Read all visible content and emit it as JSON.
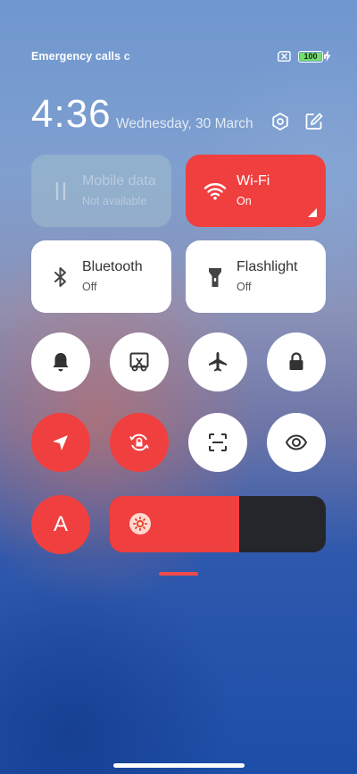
{
  "status_bar": {
    "carrier": "Emergency calls",
    "carrier_suffix": "c",
    "battery_level": 100,
    "battery_text": "100",
    "sim_icon": "sim-error-icon",
    "charging_icon": "bolt-icon"
  },
  "header": {
    "time": "4:36",
    "date": "Wednesday, 30 March",
    "settings_icon": "settings-hexagon-icon",
    "edit_icon": "edit-icon"
  },
  "tiles": {
    "mobile_data": {
      "label": "Mobile data",
      "status": "Not available",
      "icon": "data-arrows-icon"
    },
    "wifi": {
      "label": "Wi-Fi",
      "status": "On",
      "icon": "wifi-icon"
    },
    "bluetooth": {
      "label": "Bluetooth",
      "status": "Off",
      "icon": "bluetooth-icon"
    },
    "flashlight": {
      "label": "Flashlight",
      "status": "Off",
      "icon": "flashlight-icon"
    }
  },
  "toggles_row1": [
    "bell-icon",
    "screenshot-icon",
    "airplane-icon",
    "lock-icon"
  ],
  "toggles_row2": [
    "location-icon",
    "rotation-lock-icon",
    "scanner-icon",
    "eye-icon"
  ],
  "auto_brightness": {
    "letter": "A"
  },
  "brightness": {
    "level": 0.6,
    "icon": "brightness-sun-icon"
  },
  "colors": {
    "accent_red": "#f03f3f",
    "tile_white": "#ffffff",
    "slider_track": "#25262c",
    "battery_green": "#6ee06b"
  }
}
